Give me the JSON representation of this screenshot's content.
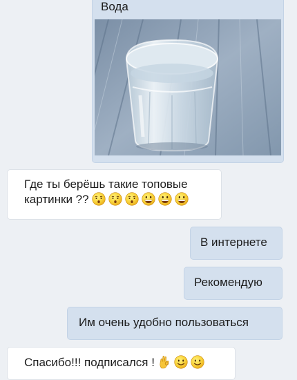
{
  "photo_message": {
    "caption": "Вода",
    "image": "glass-of-water-photo"
  },
  "messages": [
    {
      "direction": "incoming",
      "line1": "Где ты берёшь такие топовые",
      "line2": "картинки ??",
      "emojis": [
        "hushed-face-emoji",
        "hushed-face-emoji",
        "hushed-face-emoji",
        "grinning-face-emoji",
        "grinning-face-emoji",
        "grinning-face-emoji"
      ]
    },
    {
      "direction": "outgoing",
      "text": "В интернете"
    },
    {
      "direction": "outgoing",
      "text": "Рекомендую"
    },
    {
      "direction": "outgoing",
      "text": "Им очень удобно пользоваться"
    },
    {
      "direction": "incoming",
      "text": "Спасибо!!! подписался !",
      "emojis": [
        "ok-hand-emoji",
        "smiling-face-emoji",
        "smiling-face-emoji"
      ]
    }
  ],
  "colors": {
    "background": "#edf0f4",
    "outgoing_bubble": "#d4e0ee",
    "incoming_bubble": "#ffffff"
  }
}
